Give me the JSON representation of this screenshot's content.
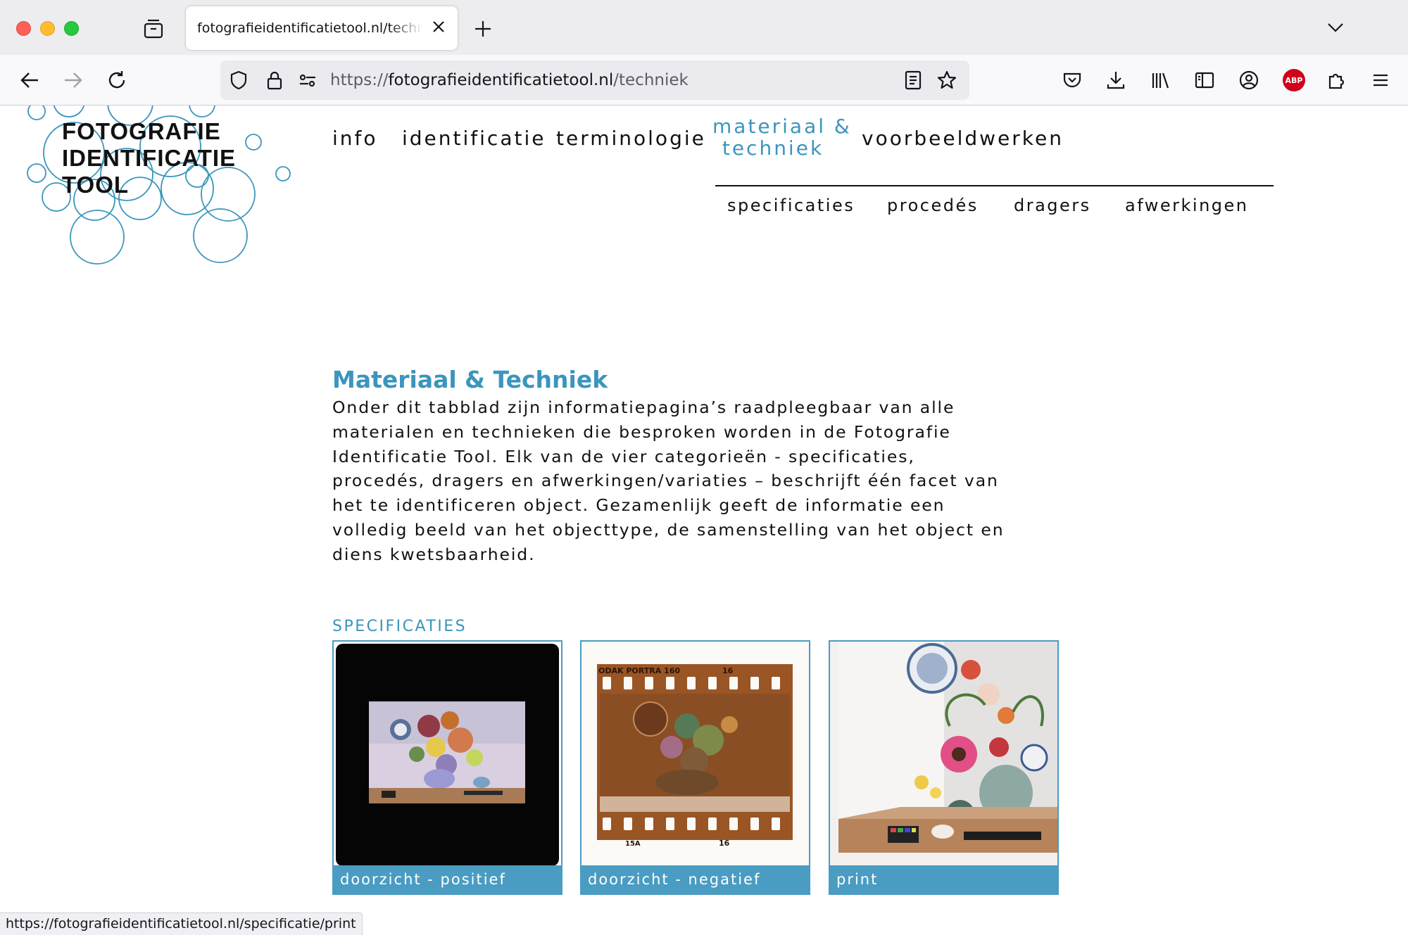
{
  "browser": {
    "tab_title": "fotografieidentificatietool.nl/techniek",
    "url_scheme": "https://",
    "url_host": "fotografieidentificatietool.nl",
    "url_path": "/techniek",
    "status_url": "https://fotografieidentificatietool.nl/specificatie/print",
    "adblock_label": "ABP"
  },
  "logo": {
    "line1": "FOTOGRAFIE",
    "line2": "IDENTIFICATIE",
    "line3": "TOOL"
  },
  "nav": {
    "items": [
      {
        "label": "info"
      },
      {
        "label": "identificatie"
      },
      {
        "label": "terminologie"
      },
      {
        "label": "materiaal & techniek",
        "line1": "materiaal &",
        "line2": "techniek",
        "active": true
      },
      {
        "label": "voorbeeldwerken"
      }
    ],
    "sub": [
      "specificaties",
      "procedés",
      "dragers",
      "afwerkingen"
    ]
  },
  "main": {
    "heading": "Materiaal & Techniek",
    "intro_lines": [
      "Onder dit tabblad zijn informatiepagina’s raadpleegbaar van alle",
      "materialen en technieken die besproken worden in de Fotografie",
      "Identificatie Tool. Elk van de vier categorieën - specificaties,",
      "procedés, dragers en afwerkingen/variaties – beschrijft één facet van",
      "het te identificeren object. Gezamenlijk geeft de informatie een",
      "volledig beeld van het objecttype, de samenstelling van het object en",
      "diens kwetsbaarheid."
    ],
    "section_title": "SPECIFICATIES",
    "cards": [
      {
        "caption": "doorzicht - positief"
      },
      {
        "caption": "doorzicht - negatief",
        "film_label": "ODAK PORTRA 160",
        "frame_num": "16",
        "edge_code": "15A"
      },
      {
        "caption": "print"
      }
    ]
  },
  "colors": {
    "accent": "#3b95bd",
    "caption_bg": "#4a9cc2",
    "text": "#111111"
  }
}
